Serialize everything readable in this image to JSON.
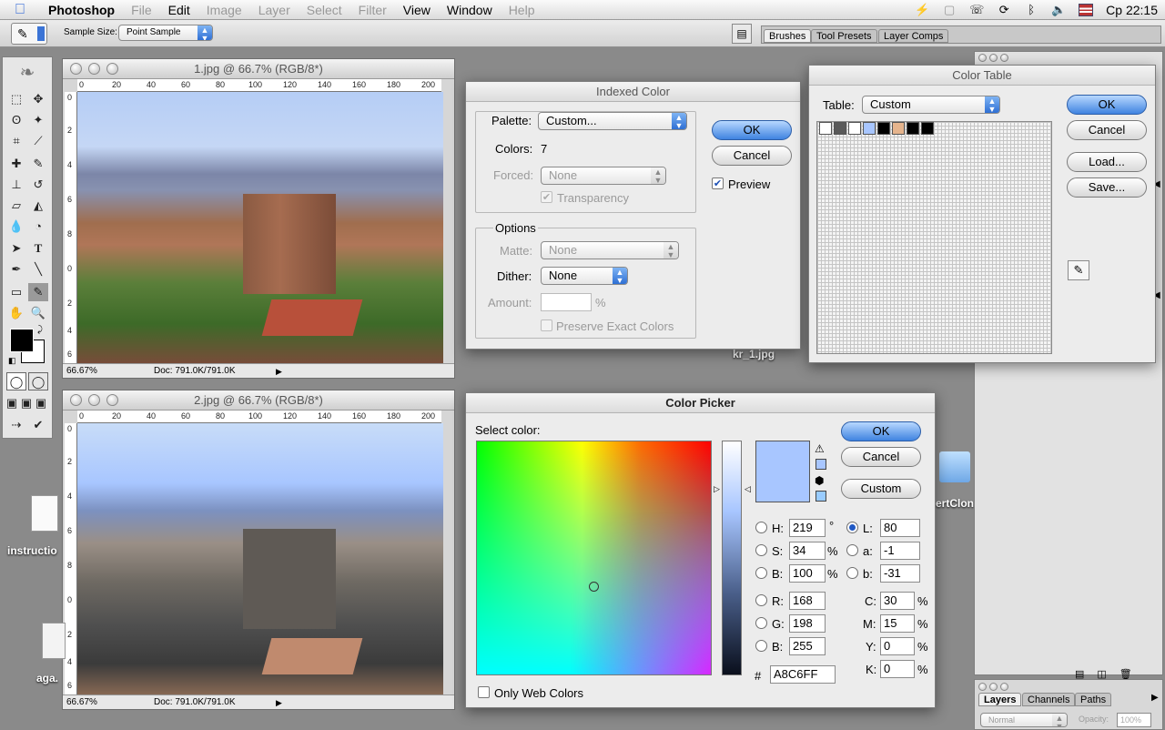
{
  "menubar": {
    "app": "Photoshop",
    "items": [
      "File",
      "Edit",
      "Image",
      "Layer",
      "Select",
      "Filter",
      "View",
      "Window",
      "Help"
    ],
    "clock": "Ср 22:15",
    "status_icons": [
      "bolt-icon",
      "stuffit-icon",
      "phone-icon",
      "sync-icon",
      "bluetooth-icon",
      "volume-icon",
      "flag-icon"
    ]
  },
  "options_bar": {
    "sample_size_label": "Sample Size:",
    "sample_size_value": "Point Sample",
    "palette_well_tabs": [
      "Brushes",
      "Tool Presets",
      "Layer Comps"
    ]
  },
  "doc1": {
    "title": "1.jpg @ 66.7% (RGB/8*)",
    "zoom": "66.67%",
    "doc_size": "Doc: 791.0K/791.0K",
    "ruler_h": [
      "0",
      "20",
      "40",
      "60",
      "80",
      "100",
      "120",
      "140",
      "160",
      "180",
      "200"
    ],
    "ruler_v": [
      "0",
      "2",
      "4",
      "6",
      "8",
      "0",
      "2",
      "4",
      "6"
    ]
  },
  "doc2": {
    "title": "2.jpg @ 66.7% (RGB/8*)",
    "zoom": "66.67%",
    "doc_size": "Doc: 791.0K/791.0K",
    "ruler_h": [
      "0",
      "20",
      "40",
      "60",
      "80",
      "100",
      "120",
      "140",
      "160",
      "180",
      "200"
    ],
    "ruler_v": [
      "0",
      "2",
      "4",
      "6",
      "8",
      "0",
      "2",
      "4",
      "6"
    ]
  },
  "desktop": {
    "kr_file": "kr_1.jpg",
    "instructions_file": "instructio",
    "aga_file": "aga.",
    "clone_file": "ertClon"
  },
  "indexed_color": {
    "title": "Indexed Color",
    "palette_label": "Palette:",
    "palette_value": "Custom...",
    "colors_label": "Colors:",
    "colors_value": "7",
    "forced_label": "Forced:",
    "forced_value": "None",
    "transparency_label": "Transparency",
    "options_label": "Options",
    "matte_label": "Matte:",
    "matte_value": "None",
    "dither_label": "Dither:",
    "dither_value": "None",
    "amount_label": "Amount:",
    "amount_unit": "%",
    "preserve_label": "Preserve Exact Colors",
    "ok": "OK",
    "cancel": "Cancel",
    "preview_label": "Preview"
  },
  "color_table": {
    "title": "Color Table",
    "table_label": "Table:",
    "table_value": "Custom",
    "ok": "OK",
    "cancel": "Cancel",
    "load": "Load...",
    "save": "Save...",
    "swatches": [
      "#ffffff",
      "#5a5a5a",
      "#ffffff",
      "#a8c6ff",
      "#000000",
      "#e5b48d",
      "#000000",
      "#000000"
    ]
  },
  "color_picker": {
    "title": "Color Picker",
    "select_color_label": "Select color:",
    "ok": "OK",
    "cancel": "Cancel",
    "custom": "Custom",
    "h_label": "H:",
    "h_value": "219",
    "h_unit": "°",
    "s_label": "S:",
    "s_value": "34",
    "s_unit": "%",
    "b_label": "B:",
    "b_value": "100",
    "b_unit": "%",
    "l_label": "L:",
    "l_value": "80",
    "a_label": "a:",
    "a_value": "-1",
    "bb_label": "b:",
    "bb_value": "-31",
    "r_label": "R:",
    "r_value": "168",
    "g_label": "G:",
    "g_value": "198",
    "blue_label": "B:",
    "blue_value": "255",
    "c_label": "C:",
    "c_value": "30",
    "c_unit": "%",
    "m_label": "M:",
    "m_value": "15",
    "m_unit": "%",
    "y_label": "Y:",
    "y_value": "0",
    "y_unit": "%",
    "k_label": "K:",
    "k_value": "0",
    "k_unit": "%",
    "hex_label": "#",
    "hex_value": "A8C6FF",
    "only_web_label": "Only Web Colors",
    "current_color": "#a8c6ff"
  },
  "layers_palette": {
    "tabs": [
      "Layers",
      "Channels",
      "Paths"
    ],
    "blend_mode": "Normal",
    "opacity_label": "Opacity:",
    "opacity_value": "100%"
  }
}
